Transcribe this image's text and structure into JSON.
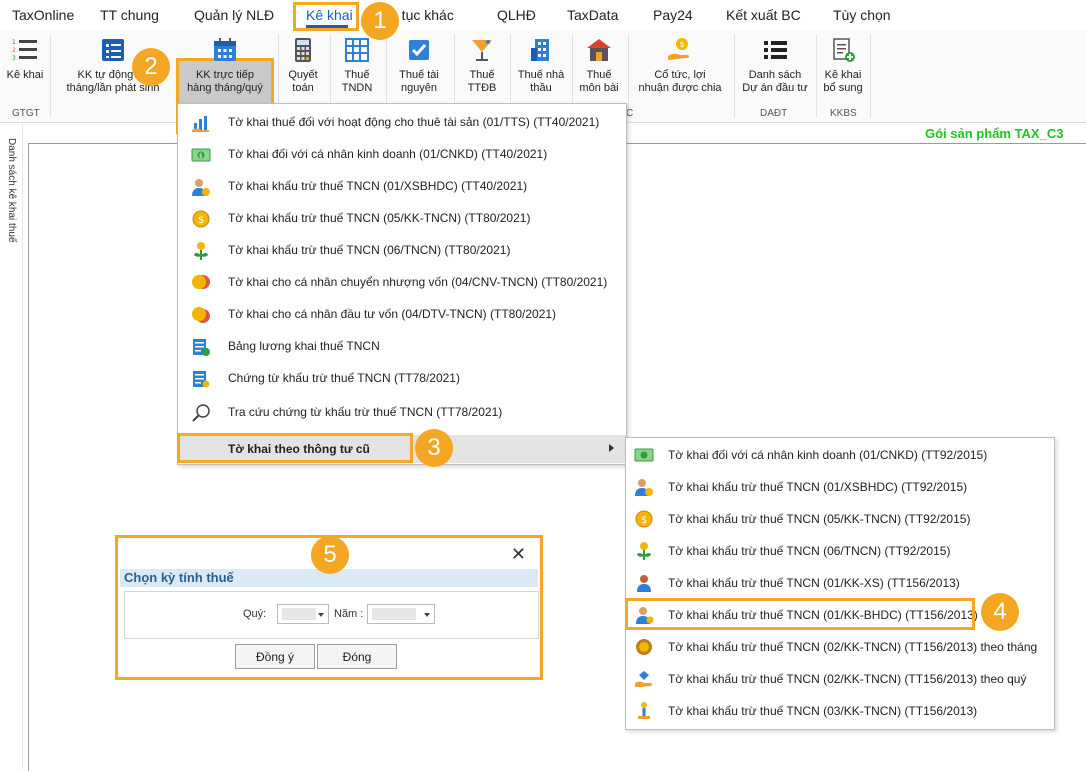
{
  "menubar": {
    "items": [
      "TaxOnline",
      "TT chung",
      "Quản lý NLĐ",
      "Kê khai",
      "Thủ tục khác",
      "QLHĐ",
      "TaxData",
      "Pay24",
      "Kết xuất BC",
      "Tùy chọn"
    ],
    "visible_partial": "ủ tục khác",
    "active": "Kê khai"
  },
  "ribbon": {
    "buttons": {
      "kekhai": "Kê khai",
      "kk_tudong": [
        "KK tự động ha",
        "tháng/lần phát sinh"
      ],
      "kk_tructiep": [
        "KK trực tiếp",
        "hàng tháng/quý"
      ],
      "quyettoan": [
        "Quyết",
        "toán"
      ],
      "thue_tndn": [
        "Thuế",
        "TNDN"
      ],
      "thue_tainguyen": [
        "Thuế tài",
        "nguyên"
      ],
      "thue_ttdb": [
        "Thuế",
        "TTĐB"
      ],
      "thue_nhathau": [
        "Thuế nhà",
        "thầu"
      ],
      "thue_monbai": [
        "Thuế",
        "môn bài"
      ],
      "cotuc": [
        "Cổ tức, lợi",
        "nhuận được chia"
      ],
      "danhsach_duan": [
        "Danh sách",
        "Dự án đầu tư"
      ],
      "kekhai_bosung": [
        "Kê khai",
        "bổ sung"
      ]
    },
    "groups": {
      "gtgt": "GTGT",
      "c": "C",
      "daadt": "DAĐT",
      "kkbs": "KKBS"
    }
  },
  "product_label": "Gói sản phẩm TAX_C3",
  "side_panel_label": "Danh sách kê khai thuế",
  "dropdown": {
    "items": [
      {
        "label": "Tờ khai thuế đối với hoạt động cho thuê tài sản (01/TTS) (TT40/2021)",
        "icon": "rental-chart-icon"
      },
      {
        "label": "Tờ khai đối với cá nhân kinh doanh (01/CNKD) (TT40/2021)",
        "icon": "money-bill-icon"
      },
      {
        "label": "Tờ khai khấu trừ thuế TNCN (01/XSBHDC) (TT40/2021)",
        "icon": "person-coin-icon"
      },
      {
        "label": "Tờ khai khấu trừ thuế TNCN (05/KK-TNCN) (TT80/2021)",
        "icon": "dollar-coin-icon"
      },
      {
        "label": "Tờ khai khấu trừ thuế TNCN (06/TNCN) (TT80/2021)",
        "icon": "money-plant-icon"
      },
      {
        "label": "Tờ khai cho cá nhân chuyển nhượng vốn (04/CNV-TNCN) (TT80/2021)",
        "icon": "coin-transfer-icon"
      },
      {
        "label": "Tờ khai cho cá nhân đầu tư vốn (04/DTV-TNCN) (TT80/2021)",
        "icon": "coin-invest-icon"
      },
      {
        "label": "Bảng lương khai thuế TNCN",
        "icon": "payroll-doc-icon"
      },
      {
        "label": "Chứng từ khấu trừ thuế TNCN (TT78/2021)",
        "icon": "document-icon"
      },
      {
        "label": "Tra cứu chứng từ khấu trừ thuế TNCN (TT78/2021)",
        "icon": "magnifier-icon"
      },
      {
        "label": "Tờ khai theo thông tư cũ",
        "icon": ""
      }
    ]
  },
  "submenu": {
    "items": [
      {
        "label": "Tờ khai đối với cá nhân kinh doanh (01/CNKD) (TT92/2015)",
        "icon": "money-bill-icon"
      },
      {
        "label": "Tờ khai khấu trừ thuế TNCN (01/XSBHDC) (TT92/2015)",
        "icon": "person-coin-icon"
      },
      {
        "label": "Tờ khai khấu trừ thuế TNCN (05/KK-TNCN) (TT92/2015)",
        "icon": "dollar-coin-icon"
      },
      {
        "label": "Tờ khai khấu trừ thuế TNCN (06/TNCN) (TT92/2015)",
        "icon": "money-plant-icon"
      },
      {
        "label": "Tờ khai khấu trừ thuế TNCN (01/KK-XS) (TT156/2013)",
        "icon": "woman-person-icon"
      },
      {
        "label": "Tờ khai khấu trừ thuế TNCN (01/KK-BHDC) (TT156/2013)",
        "icon": "person-star-icon"
      },
      {
        "label": "Tờ khai khấu trừ thuế TNCN (02/KK-TNCN) (TT156/2013) theo tháng",
        "icon": "gear-coin-icon"
      },
      {
        "label": "Tờ khai khấu trừ thuế TNCN (02/KK-TNCN) (TT156/2013) theo quý",
        "icon": "hand-diamond-icon"
      },
      {
        "label": "Tờ khai khấu trừ thuế TNCN (03/KK-TNCN) (TT156/2013)",
        "icon": "coin-stack-icon"
      }
    ]
  },
  "dialog": {
    "title": "Chọn kỳ tính thuế",
    "quarter_label": "Quý:",
    "year_label": "Năm :",
    "ok_label": "Đồng ý",
    "close_label": "Đóng",
    "close_icon": "close-icon"
  },
  "badges": [
    "1",
    "2",
    "3",
    "4",
    "5"
  ],
  "colors": {
    "highlight": "#f5a623",
    "accent": "#1a5fb4",
    "product": "#1ec31e"
  }
}
